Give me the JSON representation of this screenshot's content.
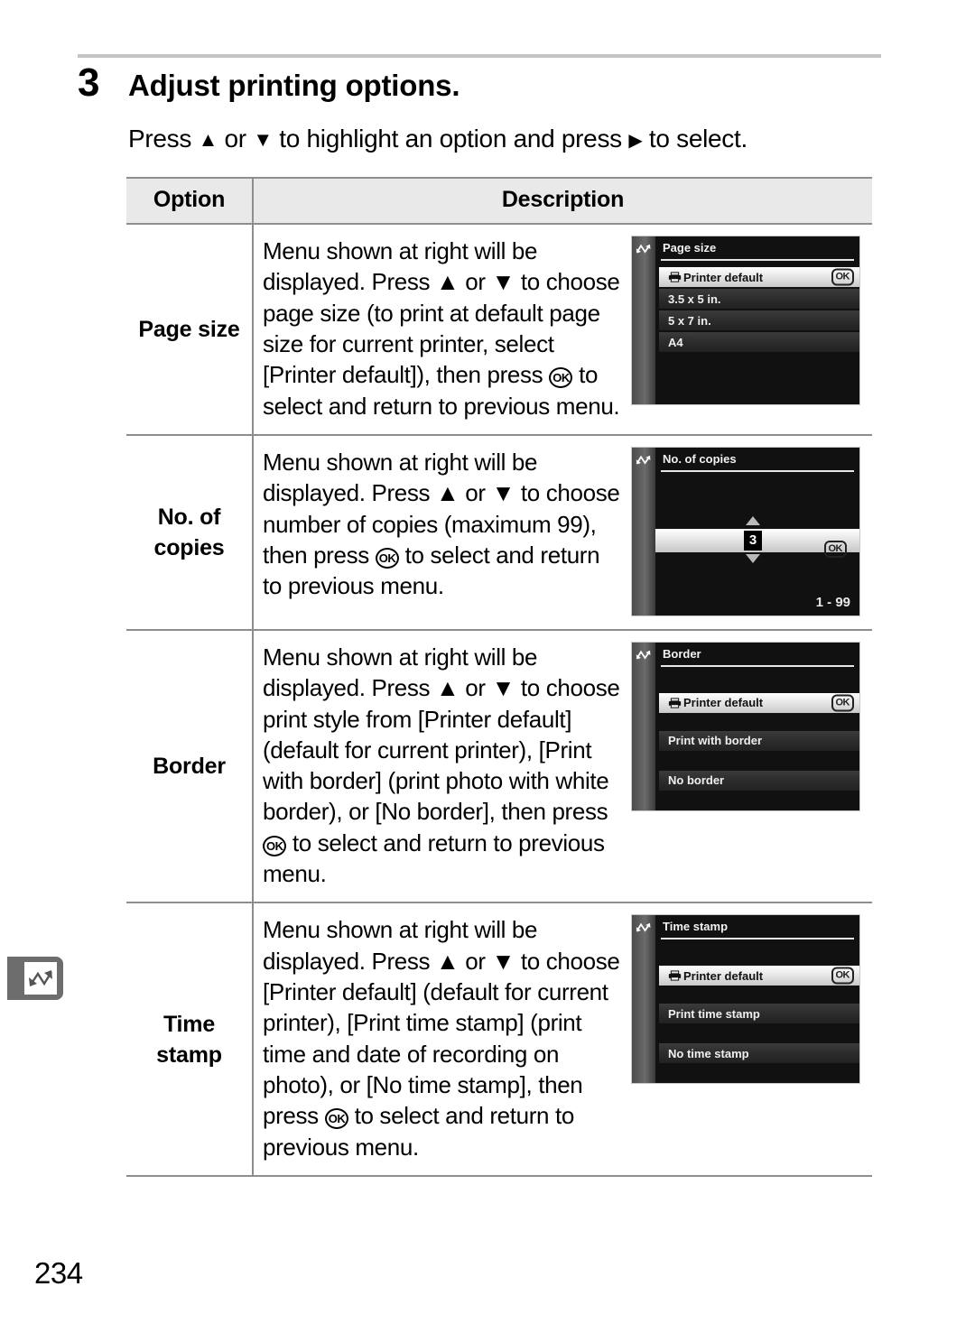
{
  "page": {
    "number": "234",
    "side_tab_icon": "interface-zigzag-arrow-icon"
  },
  "step": {
    "number": "3",
    "title": "Adjust printing options.",
    "instruction_pre": "Press ",
    "instruction_mid1": " or ",
    "instruction_mid2": " to highlight an option and press ",
    "instruction_post": " to select.",
    "up_arrow": "▲",
    "down_arrow": "▼",
    "right_arrow": "▶"
  },
  "table": {
    "headers": {
      "option": "Option",
      "description": "Description"
    },
    "rows": [
      {
        "option": "Page size",
        "description_parts": [
          "Menu shown at right will be displayed.  Press ",
          "▲",
          " or ",
          "▼",
          " to choose page size (to print at default page size for current printer, select [Printer default]), then press ",
          "OK",
          " to select and return to previous menu."
        ],
        "screen": {
          "type": "list",
          "title": "Page size",
          "items": [
            {
              "label": "Printer default",
              "selected": true,
              "printer_icon": true,
              "ok_badge": "OK"
            },
            {
              "label": "3.5 x 5 in.",
              "selected": false,
              "printer_icon": false
            },
            {
              "label": "5 x 7 in.",
              "selected": false,
              "printer_icon": false
            },
            {
              "label": "A4",
              "selected": false,
              "printer_icon": false
            }
          ],
          "layout": "compact"
        }
      },
      {
        "option": "No. of copies",
        "option_line1": "No.  of",
        "option_line2": "copies",
        "description_parts": [
          "Menu shown at right will be displayed.  Press ",
          "▲",
          " or ",
          "▼",
          " to choose number of copies (maximum 99), then press ",
          "OK",
          " to select and return to previous menu."
        ],
        "screen": {
          "type": "stepper",
          "title": "No. of copies",
          "value": "3",
          "range": "1 - 99",
          "ok_badge": "OK"
        }
      },
      {
        "option": "Border",
        "description_parts": [
          "Menu shown at right will be displayed.  Press ",
          "▲",
          " or ",
          "▼",
          " to choose print style from [Printer default] (default for current printer), [Print with border] (print photo with white border), or [No border], then press ",
          "OK",
          " to select and return to previous menu."
        ],
        "screen": {
          "type": "list",
          "title": "Border",
          "items": [
            {
              "label": "Printer default",
              "selected": true,
              "printer_icon": true,
              "ok_badge": "OK"
            },
            {
              "label": "Print with border",
              "selected": false,
              "printer_icon": false
            },
            {
              "label": "No border",
              "selected": false,
              "printer_icon": false
            }
          ],
          "layout": "spaced"
        }
      },
      {
        "option": "Time stamp",
        "option_line1": "Time",
        "option_line2": "stamp",
        "description_parts": [
          "Menu shown at right will be displayed.  Press ",
          "▲",
          " or ",
          "▼",
          " to choose [Printer default] (default for current printer), [Print time stamp] (print time and date of recording on photo), or [No time stamp], then press ",
          "OK",
          " to select and return to previous menu."
        ],
        "screen": {
          "type": "list",
          "title": "Time stamp",
          "items": [
            {
              "label": "Printer default",
              "selected": true,
              "printer_icon": true,
              "ok_badge": "OK"
            },
            {
              "label": "Print time stamp",
              "selected": false,
              "printer_icon": false
            },
            {
              "label": "No time stamp",
              "selected": false,
              "printer_icon": false
            }
          ],
          "layout": "spaced"
        }
      }
    ]
  },
  "colors": {
    "rule": "#c4c4c4",
    "table_border": "#8e8e8e",
    "header_bg": "#e9e9e9",
    "lcd_bg": "#111111",
    "lcd_sidebar": "#6b6b6b",
    "side_tab": "#6d6d6d"
  }
}
